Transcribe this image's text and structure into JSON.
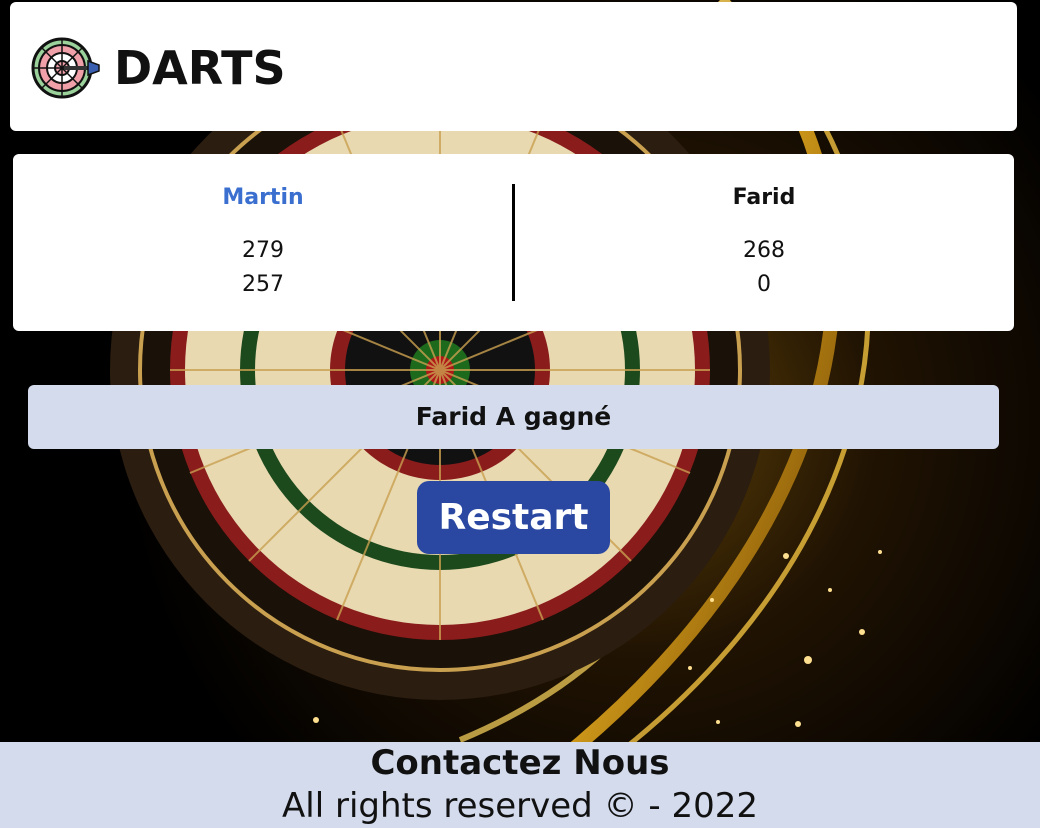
{
  "header": {
    "title": "DARTS",
    "logo_icon": "dartboard-icon"
  },
  "scoreboard": {
    "players": [
      {
        "name": "Martin",
        "active": true,
        "scores": [
          "279",
          "257"
        ]
      },
      {
        "name": "Farid",
        "active": false,
        "scores": [
          "268",
          "0"
        ]
      }
    ]
  },
  "result": {
    "message": "Farid A gagné"
  },
  "controls": {
    "restart_label": "Restart"
  },
  "footer": {
    "contact_label": "Contactez Nous",
    "copyright": "All rights reserved © - 2022"
  },
  "colors": {
    "active_player": "#3a6fd0",
    "button": "#2a48a2",
    "banner": "#d3dbed"
  }
}
